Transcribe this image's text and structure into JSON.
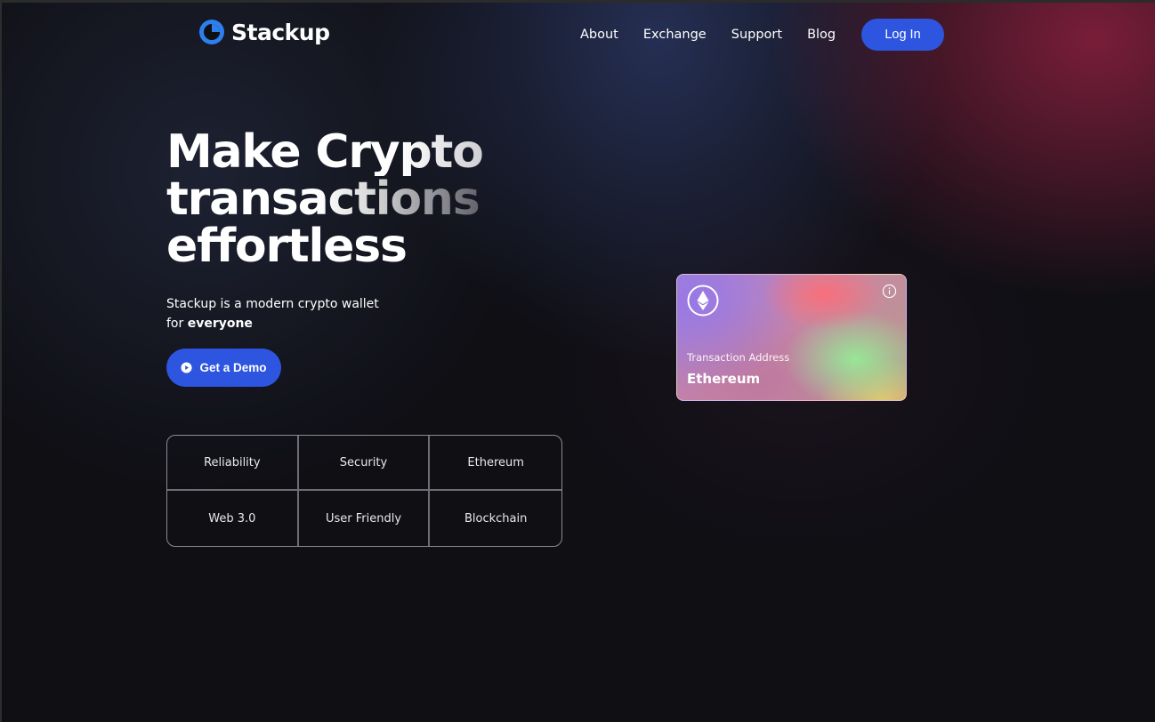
{
  "brand": {
    "name": "Stackup",
    "logo_icon": "stackup-logo-icon",
    "accent_color": "#2d55e0"
  },
  "nav": {
    "links": [
      {
        "label": "About"
      },
      {
        "label": "Exchange"
      },
      {
        "label": "Support"
      },
      {
        "label": "Blog"
      }
    ],
    "login_label": "Log In"
  },
  "hero": {
    "headline_lines": [
      "Make Crypto",
      "transactions",
      "effortless"
    ],
    "subtitle_line1": "Stackup is a modern crypto wallet",
    "subtitle_line2_prefix": "for ",
    "subtitle_line2_bold": "everyone",
    "cta_label": "Get a Demo",
    "cta_icon": "play-circle-icon"
  },
  "features": {
    "items": [
      {
        "label": "Reliability"
      },
      {
        "label": "Security"
      },
      {
        "label": "Ethereum"
      },
      {
        "label": "Web 3.0"
      },
      {
        "label": "User Friendly"
      },
      {
        "label": "Blockchain"
      }
    ]
  },
  "card": {
    "icon": "ethereum-icon",
    "info_icon": "info-icon",
    "label": "Transaction Address",
    "value": "Ethereum"
  }
}
